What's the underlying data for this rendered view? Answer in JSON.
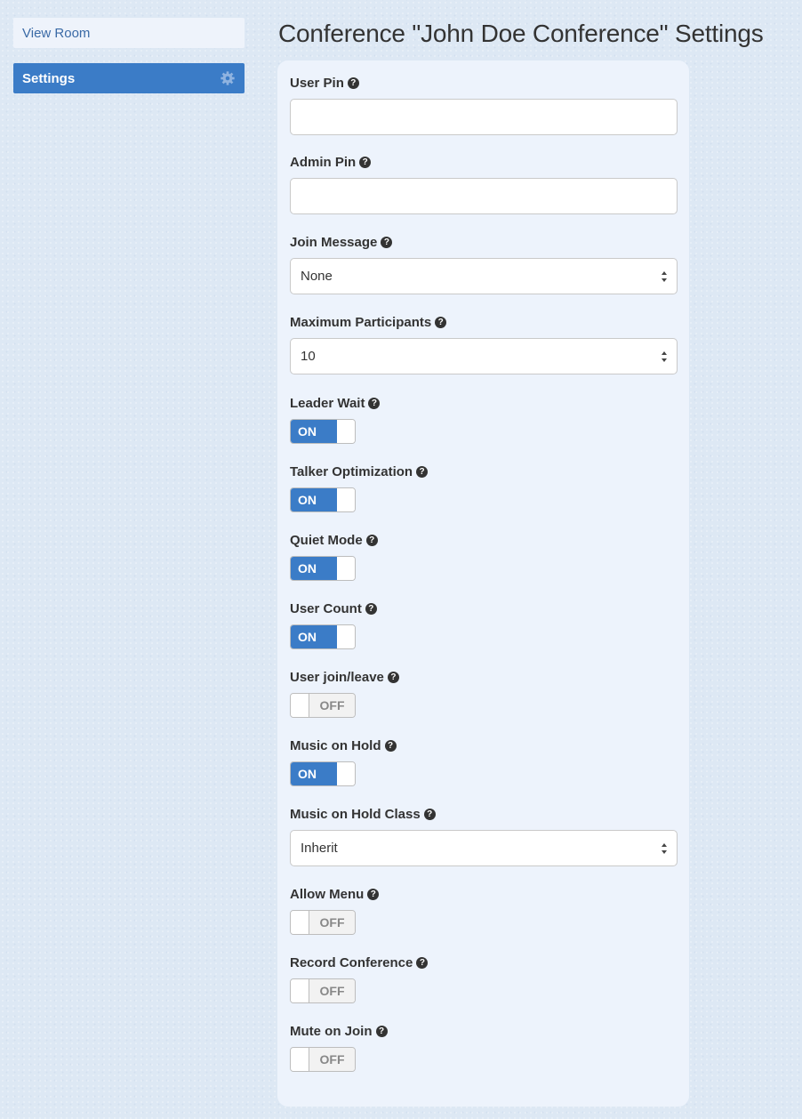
{
  "sidebar": {
    "view_room": "View Room",
    "settings": "Settings"
  },
  "page_title": "Conference \"John Doe Conference\" Settings",
  "help_glyph": "?",
  "fields": {
    "user_pin": {
      "label": "User Pin",
      "value": ""
    },
    "admin_pin": {
      "label": "Admin Pin",
      "value": ""
    },
    "join_message": {
      "label": "Join Message",
      "value": "None"
    },
    "maximum_participants": {
      "label": "Maximum Participants",
      "value": "10"
    },
    "leader_wait": {
      "label": "Leader Wait",
      "state": "ON"
    },
    "talker_optimization": {
      "label": "Talker Optimization",
      "state": "ON"
    },
    "quiet_mode": {
      "label": "Quiet Mode",
      "state": "ON"
    },
    "user_count": {
      "label": "User Count",
      "state": "ON"
    },
    "user_join_leave": {
      "label": "User join/leave",
      "state": "OFF"
    },
    "music_on_hold": {
      "label": "Music on Hold",
      "state": "ON"
    },
    "music_on_hold_class": {
      "label": "Music on Hold Class",
      "value": "Inherit"
    },
    "allow_menu": {
      "label": "Allow Menu",
      "state": "OFF"
    },
    "record_conference": {
      "label": "Record Conference",
      "state": "OFF"
    },
    "mute_on_join": {
      "label": "Mute on Join",
      "state": "OFF"
    }
  },
  "colors": {
    "accent": "#3b7cc7",
    "background": "#dde8f4",
    "panel": "#edf3fc"
  }
}
